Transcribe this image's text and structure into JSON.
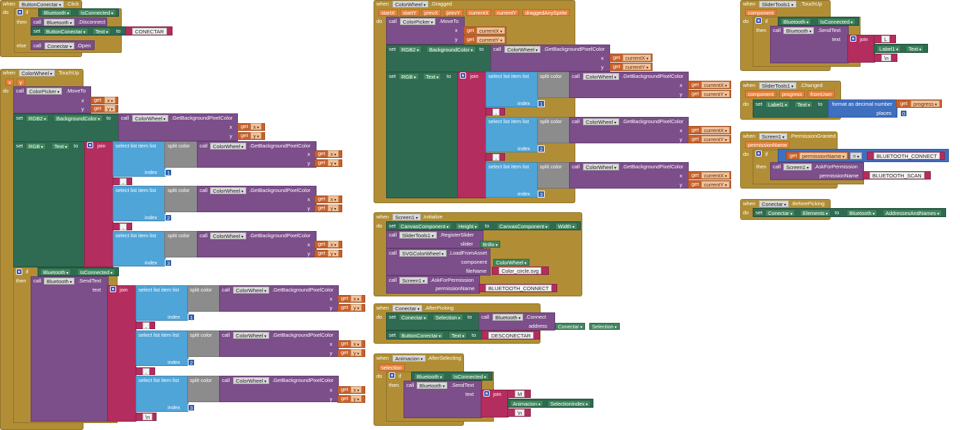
{
  "kw": {
    "when": "when",
    "do": "do",
    "then": "then",
    "else": "else",
    "if": "if",
    "call": "call",
    "set": "set",
    "to": "to",
    "get": "get",
    "join": "join",
    "x": "x",
    "y": "y",
    "index": "index",
    "text": "text",
    "slider": "slider",
    "component": "component",
    "fileName": "fileName",
    "permissionName": "permissionName",
    "address": "address",
    "places": "places",
    "select_list_item": "select list item  list",
    "split_color": "split color",
    "format_decimal": "format as decimal number"
  },
  "blocks": {
    "b1": {
      "component": "ButtonConectar",
      "event": ".Click",
      "bluetooth": "Bluetooth",
      "is_connected": "IsConnected",
      "disconnect": ".Disconnect",
      "set_comp": "ButtonConectar",
      "set_prop": "Text",
      "conectar_str": "CONECTAR",
      "else_comp": "Conectar",
      "open": ".Open"
    },
    "b2": {
      "component": "ColorWheel",
      "event": ".TouchUp",
      "params": [
        "x",
        "y"
      ],
      "picker": "ColorPicker",
      "move_to": ".MoveTo",
      "rgb2": "RGB2",
      "bgcolor": "BackgroundColor",
      "colorwheel": "ColorWheel",
      "get_bg": ".GetBackgroundPixelColor",
      "rgb": "RGB",
      "text": "Text",
      "indexes": [
        "1",
        "2",
        "3"
      ],
      "comma": ",",
      "newline": "\\n",
      "bluetooth": "Bluetooth",
      "is_connected": "IsConnected",
      "send_text": ".SendText"
    },
    "b3": {
      "component": "ColorWheel",
      "event": ".Dragged",
      "params": [
        "startX",
        "startY",
        "prevX",
        "prevY",
        "currentX",
        "currentY",
        "draggedAnySprite"
      ],
      "picker": "ColorPicker",
      "move_to": ".MoveTo",
      "cx": "currentX",
      "cy": "currentY",
      "rgb2": "RGB2",
      "bgcolor": "BackgroundColor",
      "colorwheel": "ColorWheel",
      "get_bg": ".GetBackgroundPixelColor",
      "rgb": "RGB",
      "text": "Text",
      "comma": ",",
      "indexes": [
        "1",
        "2",
        "3"
      ]
    },
    "b4": {
      "component": "Screen1",
      "event": ".Initialize",
      "canvas": "CanvasComponent",
      "height": "Height",
      "width": "Width",
      "slider_tools": "SliderTools1",
      "register": ".RegisterSlider",
      "brillo": "Brillo",
      "svg": "SVGColorWheel",
      "load": ".LoadFromAsset",
      "colorwheel": "ColorWheel",
      "file": "Color_circle.svg",
      "screen": "Screen1",
      "ask": ".AskForPermission",
      "perm": "BLUETOOTH_CONNECT"
    },
    "b5": {
      "component": "Conectar",
      "event": ".AfterPicking",
      "conectar": "Conectar",
      "selection": "Selection",
      "bluetooth": "Bluetooth",
      "connect": ".Connect",
      "btn": "ButtonConectar",
      "text": "Text",
      "desconectar": "DESCONECTAR"
    },
    "b6": {
      "component": "Animacion",
      "event": ".AfterSelecting",
      "param": "selection",
      "bluetooth": "Bluetooth",
      "is_connected": "IsConnected",
      "send_text": ".SendText",
      "m": "M",
      "animacion": "Animacion",
      "selection_index": "SelectionIndex",
      "newline": "\\n"
    },
    "b7": {
      "component": "SliderTools1",
      "event": ".TouchUp",
      "param": "component",
      "bluetooth": "Bluetooth",
      "is_connected": "IsConnected",
      "send_text": ".SendText",
      "l": "L",
      "label": "Label1",
      "text": "Text",
      "newline": "\\n"
    },
    "b8": {
      "component": "SliderTools1",
      "event": ".Changed",
      "params": [
        "component",
        "progress",
        "fromUser"
      ],
      "label": "Label1",
      "text": "Text",
      "progress": "progress",
      "places": "0"
    },
    "b9": {
      "component": "Screen1",
      "event": ".PermissionGranted",
      "param": "permissionName",
      "get_param": "permissionName",
      "eq": "=",
      "connect_str": "BLUETOOTH_CONNECT",
      "screen": "Screen1",
      "ask": ".AskForPermission",
      "scan_str": "BLUETOOTH_SCAN"
    },
    "b10": {
      "component": "Conectar",
      "event": ".BeforePicking",
      "conectar": "Conectar",
      "elements": "Elements",
      "bluetooth": "Bluetooth",
      "addresses": "AddressesAndNames"
    }
  }
}
